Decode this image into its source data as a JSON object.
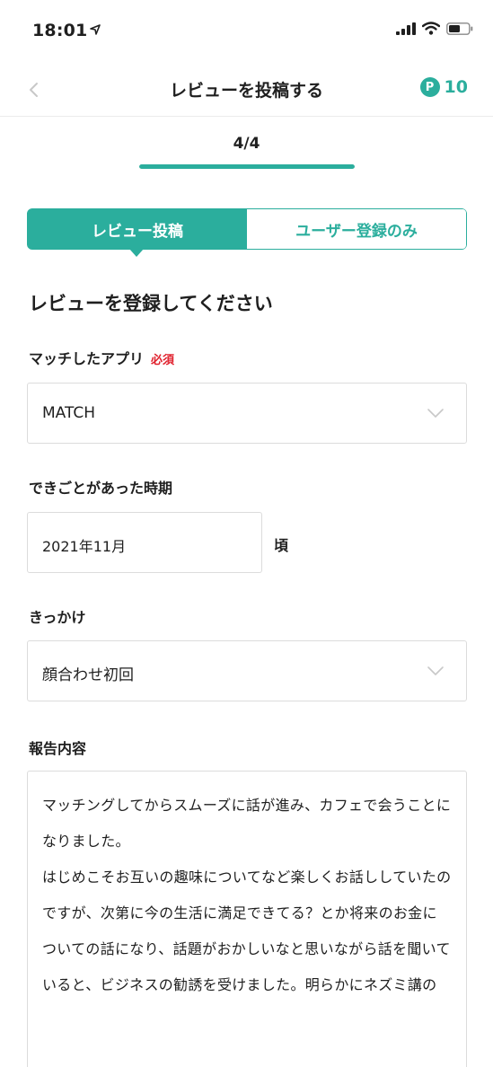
{
  "status_bar": {
    "time": "18:01",
    "location_icon": "location-arrow-icon",
    "icons": [
      "signal-icon",
      "wifi-icon",
      "battery-icon"
    ]
  },
  "nav": {
    "title": "レビューを投稿する",
    "back_icon": "chevron-left-icon",
    "points_badge": "P",
    "points_count": "10"
  },
  "progress": {
    "label": "4/4",
    "fraction": 1.0
  },
  "tabs": {
    "active": "レビュー投稿",
    "inactive": "ユーザー登録のみ"
  },
  "form": {
    "section_title": "レビューを登録してください",
    "app_label": "マッチしたアプリ",
    "required_label": "必須",
    "app_value": "MATCH",
    "period_label": "できごとがあった時期",
    "period_value": "2021年11月",
    "period_suffix": "頃",
    "trigger_label": "きっかけ",
    "trigger_value": "顔合わせ初回",
    "report_label": "報告内容",
    "report_text": "マッチングしてからスムーズに話が進み、カフェで会うことになりました。\nはじめこそお互いの趣味についてなど楽しくお話ししていたのですが、次第に今の生活に満足できてる？とか将来のお金についての話になり、話題がおかしいなと思いながら話を聞いていると、ビジネスの勧誘を受けました。明らかにネズミ講の"
  },
  "colors": {
    "accent": "#2bae9d",
    "required": "#e0202c",
    "border": "#dcdcdc"
  }
}
